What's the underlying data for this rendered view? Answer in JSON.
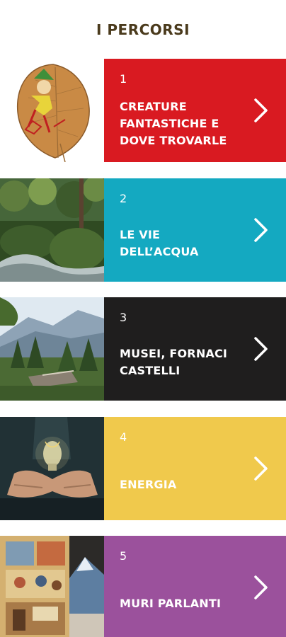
{
  "header": {
    "title": "I PERCORSI"
  },
  "routes": [
    {
      "number": "1",
      "label_lines": [
        "CREATURE",
        "FANTASTICHE E",
        "DOVE TROVARLE"
      ],
      "image": "leaf-gnome-illustration",
      "color": "#d91a21"
    },
    {
      "number": "2",
      "label_lines": [
        "LE VIE",
        "DELL’ACQUA"
      ],
      "image": "forest-stream-photo",
      "color": "#14a9c1"
    },
    {
      "number": "3",
      "label_lines": [
        "MUSEI, FORNACI",
        "CASTELLI"
      ],
      "image": "mountain-valley-bridge-photo",
      "color": "#1f1e1e"
    },
    {
      "number": "4",
      "label_lines": [
        "ENERGIA"
      ],
      "image": "hands-holding-lightbulb-photo",
      "color": "#f0c94c"
    },
    {
      "number": "5",
      "label_lines": [
        "MURI PARLANTI"
      ],
      "image": "painted-wall-mural-photo",
      "color": "#9b519c"
    }
  ],
  "icons": {
    "arrow": "chevron-right-icon"
  }
}
